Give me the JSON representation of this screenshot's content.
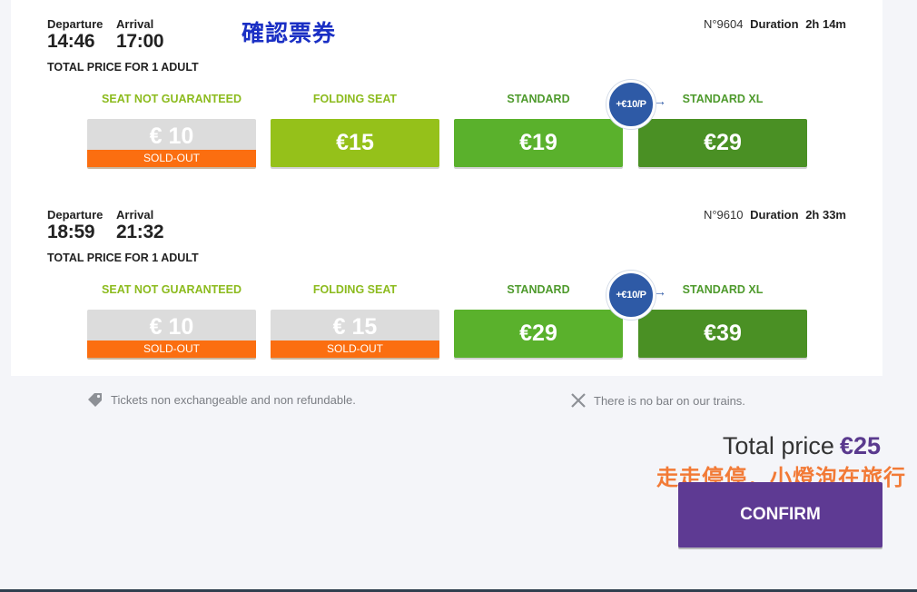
{
  "overlay": {
    "blue_text": "確認票券",
    "orange_text": "走走停停．小燈泡在旅行"
  },
  "trips": [
    {
      "departure_label": "Departure",
      "arrival_label": "Arrival",
      "departure_time": "14:46",
      "arrival_time": "17:00",
      "train_number": "N°9604",
      "duration_label": "Duration",
      "duration": "2h 14m",
      "total_price_label": "TOTAL PRICE FOR 1 ADULT",
      "upgrade_badge": "+€10/P",
      "fares": [
        {
          "class": "SEAT NOT GUARANTEED",
          "price": "€ 10",
          "status": "SOLD-OUT"
        },
        {
          "class": "FOLDING SEAT",
          "price": "€15"
        },
        {
          "class": "STANDARD",
          "price": "€19"
        },
        {
          "class": "STANDARD XL",
          "price": "€29"
        }
      ]
    },
    {
      "departure_label": "Departure",
      "arrival_label": "Arrival",
      "departure_time": "18:59",
      "arrival_time": "21:32",
      "train_number": "N°9610",
      "duration_label": "Duration",
      "duration": "2h 33m",
      "total_price_label": "TOTAL PRICE FOR 1 ADULT",
      "upgrade_badge": "+€10/P",
      "fares": [
        {
          "class": "SEAT NOT GUARANTEED",
          "price": "€ 10",
          "status": "SOLD-OUT"
        },
        {
          "class": "FOLDING SEAT",
          "price": "€ 15",
          "status": "SOLD-OUT"
        },
        {
          "class": "STANDARD",
          "price": "€29"
        },
        {
          "class": "STANDARD XL",
          "price": "€39"
        }
      ]
    }
  ],
  "notes": {
    "left": "Tickets non exchangeable and non refundable.",
    "right": "There is no bar on our trains."
  },
  "icons": {
    "note_left": "tag-icon",
    "note_right": "close-icon",
    "upgrade_arrow": "arrow-right-icon"
  },
  "summary": {
    "total_price_label": "Total price",
    "total_price_value": "€25",
    "confirm_label": "CONFIRM"
  },
  "colors": {
    "fare_lime": "#95c11a",
    "fare_green": "#5ab12c",
    "fare_dark": "#4a9024",
    "sold_out": "#fb6e10",
    "upgrade": "#2e5aa6",
    "confirm": "#5e3a93",
    "price_accent": "#5a3a8e"
  }
}
